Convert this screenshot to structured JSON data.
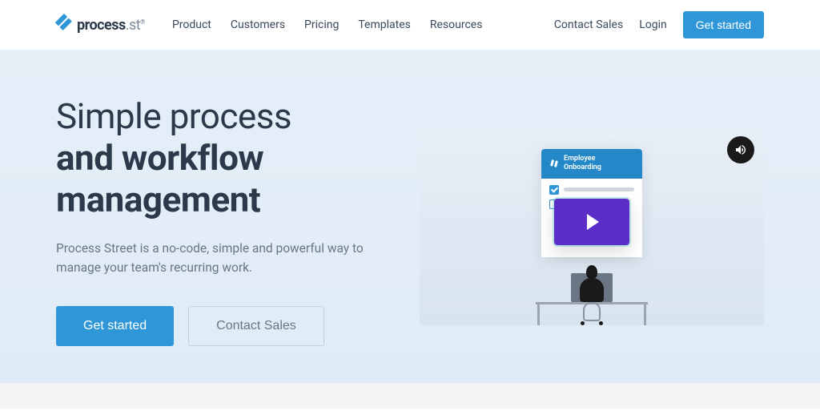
{
  "brand": {
    "name_primary": "process",
    "name_suffix": ".st"
  },
  "nav": {
    "links": [
      "Product",
      "Customers",
      "Pricing",
      "Templates",
      "Resources"
    ],
    "contact": "Contact Sales",
    "login": "Login",
    "cta": "Get started"
  },
  "hero": {
    "headline_line1": "Simple process",
    "headline_line2": "and workflow",
    "headline_line3": "management",
    "subtext": "Process Street is a no-code, simple and powerful way to manage your team's recurring work.",
    "primary_cta": "Get started",
    "secondary_cta": "Contact Sales"
  },
  "video": {
    "card_title": "Employee Onboarding"
  }
}
